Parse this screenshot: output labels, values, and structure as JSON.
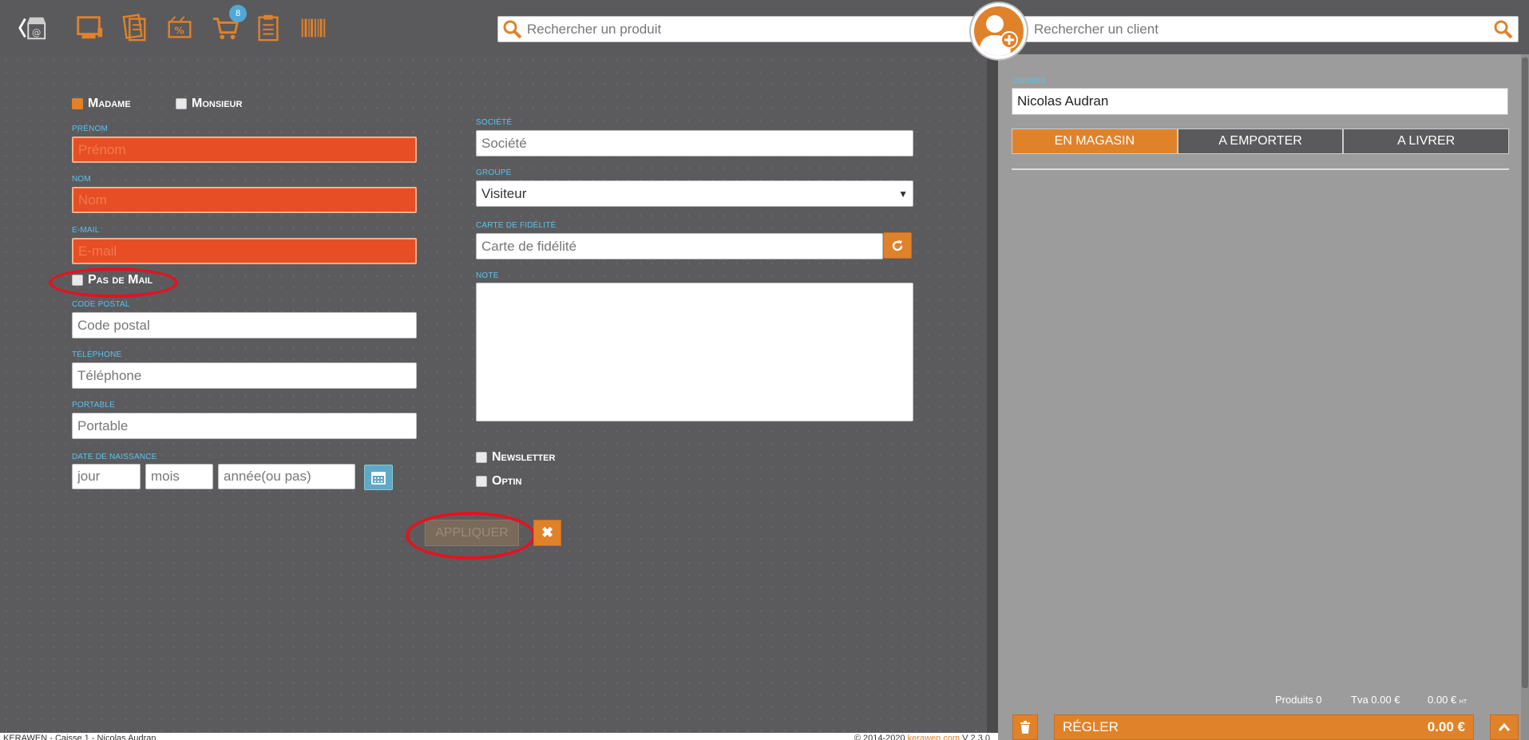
{
  "toolbar": {
    "icons": [
      "back-shop-icon",
      "pos-screen-icon",
      "catalog-icon",
      "promo-icon",
      "cart-icon",
      "clipboard-icon",
      "barcode-icon"
    ],
    "cart_badge": "8",
    "product_search_placeholder": "Rechercher un produit",
    "client_search_placeholder": "Rechercher un client"
  },
  "form": {
    "civility": {
      "madame": "Madame",
      "monsieur": "Monsieur",
      "selected": "madame"
    },
    "prenom": {
      "label": "Prénom",
      "placeholder": "Prénom"
    },
    "nom": {
      "label": "Nom",
      "placeholder": "Nom"
    },
    "email": {
      "label": "E-mail",
      "placeholder": "E-mail"
    },
    "no_mail": "Pas de Mail",
    "code_postal": {
      "label": "Code postal",
      "placeholder": "Code postal"
    },
    "telephone": {
      "label": "Téléphone",
      "placeholder": "Téléphone"
    },
    "portable": {
      "label": "Portable",
      "placeholder": "Portable"
    },
    "naissance": {
      "label": "Date de naissance",
      "jour": "jour",
      "mois": "mois",
      "annee": "année(ou pas)"
    },
    "societe": {
      "label": "Société",
      "placeholder": "Société"
    },
    "groupe": {
      "label": "Groupe",
      "value": "Visiteur"
    },
    "fidelite": {
      "label": "Carte de fidélité",
      "placeholder": "Carte de fidélité"
    },
    "note": {
      "label": "Note"
    },
    "newsletter": "Newsletter",
    "optin": "Optin",
    "apply": "APPLIQUER"
  },
  "right": {
    "cashier_label": "Caissier",
    "cashier_value": "Nicolas Audran",
    "tabs": [
      "EN MAGASIN",
      "A EMPORTER",
      "A LIVRER"
    ],
    "active_tab": 0,
    "produits": "Produits 0",
    "tva": "Tva 0.00 €",
    "ht_amount": "0.00 €",
    "ht_suffix": "HT",
    "pay_label": "RÉGLER",
    "pay_amount": "0.00 €"
  },
  "footer": {
    "left": "KERAWEN - Caisse 1 - Nicolas Audran",
    "copyright": "© 2014-2020",
    "brand": "kerawen.com",
    "version": "V 2.3.0"
  },
  "colors": {
    "accent": "#e0822a",
    "required": "#e84e25",
    "label_blue": "#58c3ef",
    "highlight": "#e5121f"
  }
}
